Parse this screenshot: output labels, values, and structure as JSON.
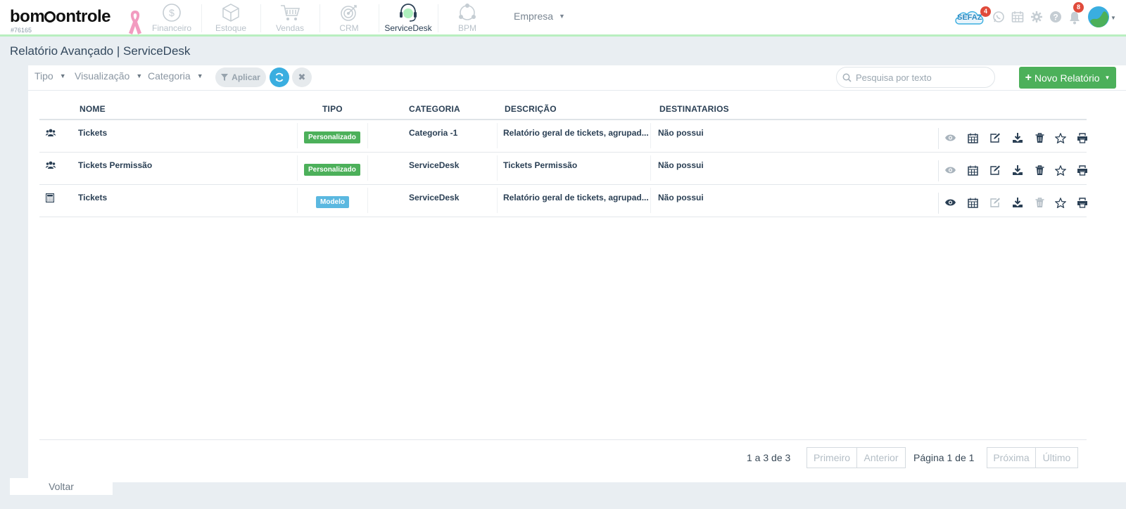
{
  "brand": {
    "logo_text": "bomControle",
    "account_id": "#76165"
  },
  "modules": [
    {
      "label": "Financeiro",
      "icon": "dollar-coin-icon",
      "active": false
    },
    {
      "label": "Estoque",
      "icon": "box-icon",
      "active": false
    },
    {
      "label": "Vendas",
      "icon": "shopping-cart-icon",
      "active": false
    },
    {
      "label": "CRM",
      "icon": "target-icon",
      "active": false
    },
    {
      "label": "ServiceDesk",
      "icon": "headset-icon",
      "active": true
    },
    {
      "label": "BPM",
      "icon": "process-circle-icon",
      "active": false
    }
  ],
  "empresa_label": "Empresa",
  "header_right": {
    "sefaz_label": "SEFAZ",
    "sefaz_badge": "4",
    "notifications_badge": "8"
  },
  "page_title": "Relatório Avançado | ServiceDesk",
  "filters": {
    "tipo": "Tipo",
    "visualizacao": "Visualização",
    "categoria": "Categoria",
    "aplicar": "Aplicar"
  },
  "search": {
    "placeholder": "Pesquisa por texto",
    "value": ""
  },
  "novo_relatorio": "Novo Relatório",
  "table": {
    "headers": {
      "nome": "NOME",
      "tipo": "TIPO",
      "categoria": "CATEGORIA",
      "descricao": "DESCRIÇÃO",
      "destinatarios": "DESTINATARIOS"
    },
    "rows": [
      {
        "icon": "users-group-icon",
        "nome": "Tickets",
        "tipo": "Personalizado",
        "tipo_color": "#4cb05a",
        "categoria": "Categoria -1",
        "descricao": "Relatório geral de tickets, agrupad...",
        "destinatarios": "Não possui"
      },
      {
        "icon": "users-group-icon",
        "nome": "Tickets Permissão",
        "tipo": "Personalizado",
        "tipo_color": "#4cb05a",
        "categoria": "ServiceDesk",
        "descricao": "Tickets Permissão",
        "destinatarios": "Não possui"
      },
      {
        "icon": "calculator-icon",
        "nome": "Tickets",
        "tipo": "Modelo",
        "tipo_color": "#5bb8e0",
        "categoria": "ServiceDesk",
        "descricao": "Relatório geral de tickets, agrupad...",
        "destinatarios": "Não possui"
      }
    ]
  },
  "pagination": {
    "count": "1 a 3 de 3",
    "primeiro": "Primeiro",
    "anterior": "Anterior",
    "pagina_prefix": "Página",
    "pagina_current": "1",
    "pagina_sep": "de",
    "pagina_total": "1",
    "proxima": "Próxima",
    "ultimo": "Último"
  },
  "voltar": "Voltar",
  "colors": {
    "accent_green": "#4cb05a",
    "accent_blue": "#3aaee0",
    "header_underline": "#b9efc0",
    "badge_red": "#e04b3b"
  }
}
